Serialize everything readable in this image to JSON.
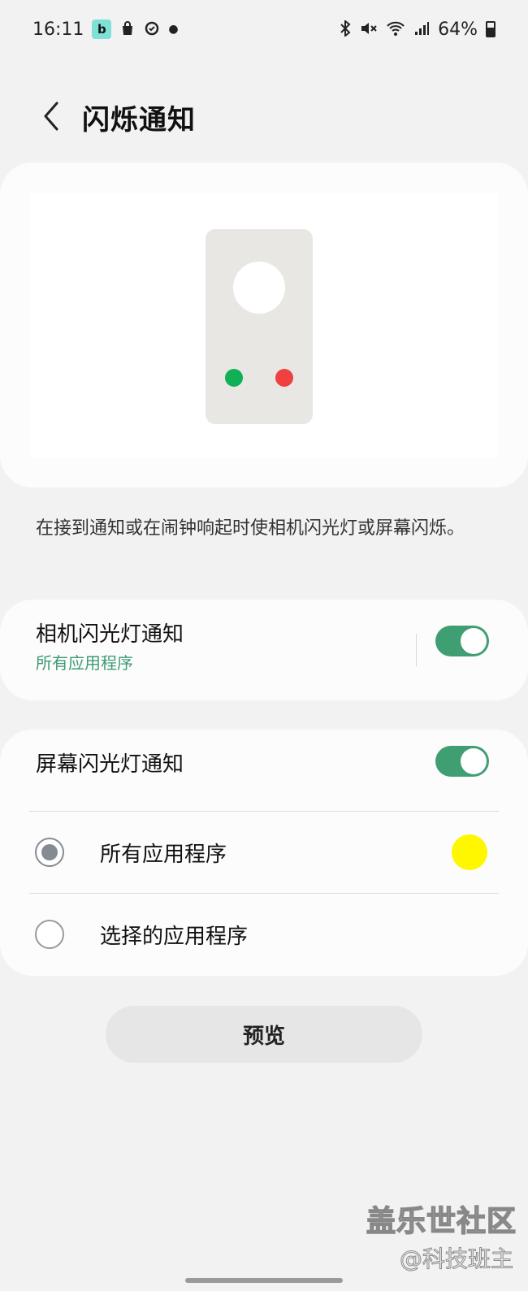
{
  "status_bar": {
    "time": "16:11",
    "app_icon_letter": "b",
    "battery_text": "64%"
  },
  "header": {
    "title": "闪烁通知"
  },
  "description": "在接到通知或在闹钟响起时使相机闪光灯或屏幕闪烁。",
  "camera_flash": {
    "title": "相机闪光灯通知",
    "subtitle": "所有应用程序",
    "enabled": true
  },
  "screen_flash": {
    "title": "屏幕闪光灯通知",
    "enabled": true,
    "options": [
      {
        "label": "所有应用程序",
        "selected": true,
        "color": "#fff700"
      },
      {
        "label": "选择的应用程序",
        "selected": false
      }
    ]
  },
  "preview_button_label": "预览",
  "illustration_colors": {
    "green": "#10b056",
    "red": "#f04040"
  },
  "accent_color": "#3f9f73",
  "watermark": {
    "line1": "盖乐世社区",
    "line2": "@科技班主"
  }
}
